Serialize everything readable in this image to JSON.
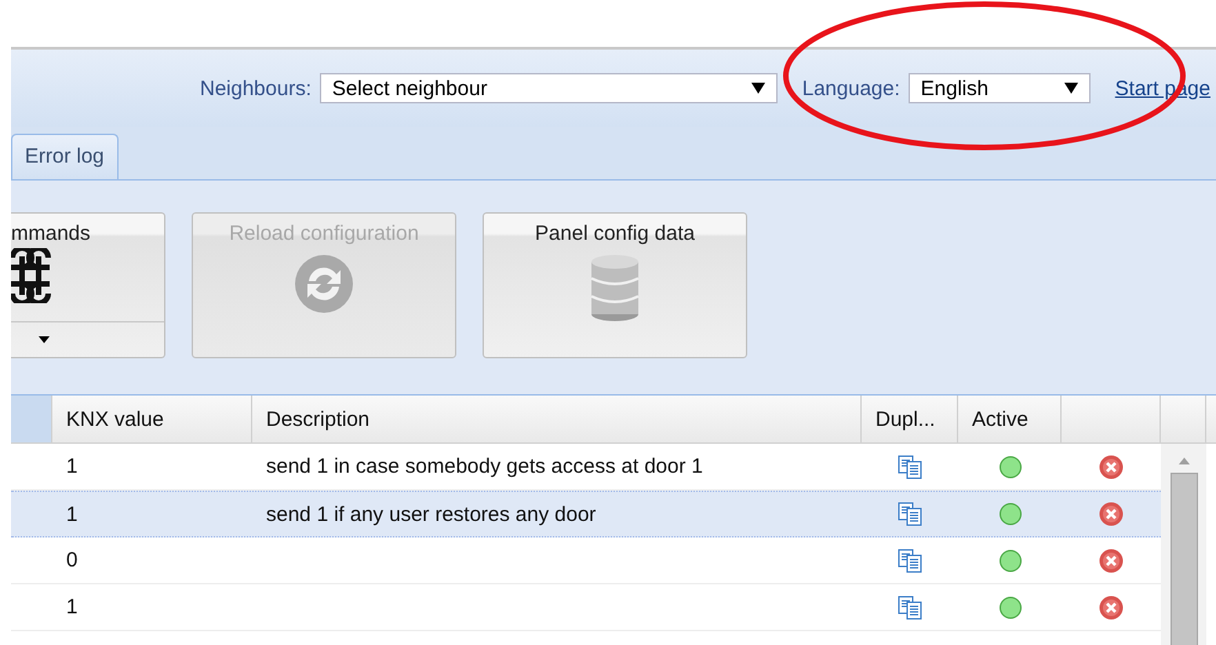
{
  "header": {
    "neighbours": {
      "label": "Neighbours:",
      "value": "Select neighbour"
    },
    "language": {
      "label": "Language:",
      "value": "English"
    },
    "start_link": "Start page"
  },
  "tabs": [
    {
      "label": "Error log",
      "selected": false
    }
  ],
  "toolbar": [
    {
      "label": "mmands",
      "kind": "menu",
      "disabled": false
    },
    {
      "label": "Reload configuration",
      "kind": "reload",
      "disabled": true
    },
    {
      "label": "Panel config data",
      "kind": "database",
      "disabled": false
    }
  ],
  "table": {
    "columns": [
      "KNX value",
      "Description",
      "Dupl...",
      "Active"
    ],
    "rows": [
      {
        "knx_value": "1",
        "description": "send 1 in case somebody gets access at door 1",
        "active": true,
        "selected": false
      },
      {
        "knx_value": "1",
        "description": "send 1 if any user restores any door",
        "active": true,
        "selected": true
      },
      {
        "knx_value": "0",
        "active": true,
        "selected": false
      },
      {
        "knx_value": "1",
        "active": true,
        "selected": false
      }
    ]
  },
  "annotation": {
    "kind": "ellipse"
  }
}
